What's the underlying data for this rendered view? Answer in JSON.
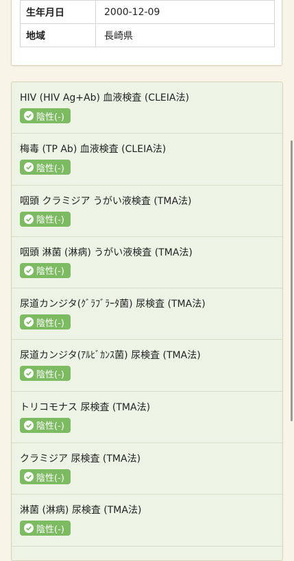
{
  "profile": {
    "rows": [
      {
        "label": "生年月日",
        "value": "2000-12-09"
      },
      {
        "label": "地域",
        "value": "長崎県"
      }
    ]
  },
  "results": [
    {
      "name": "HIV (HIV Ag+Ab) 血液検査 (CLEIA法)",
      "status": "陰性(-)"
    },
    {
      "name": "梅毒 (TP Ab) 血液検査 (CLEIA法)",
      "status": "陰性(-)"
    },
    {
      "name": "咽頭 クラミジア うがい液検査 (TMA法)",
      "status": "陰性(-)"
    },
    {
      "name": "咽頭 淋菌 (淋病) うがい液検査 (TMA法)",
      "status": "陰性(-)"
    },
    {
      "name": "尿道カンジタ(ｸﾞﾗﾌﾞﾗｰﾀ菌) 尿検査 (TMA法)",
      "status": "陰性(-)"
    },
    {
      "name": "尿道カンジタ(ｱﾙﾋﾞｶﾝｽ菌) 尿検査 (TMA法)",
      "status": "陰性(-)"
    },
    {
      "name": "トリコモナス 尿検査 (TMA法)",
      "status": "陰性(-)"
    },
    {
      "name": "クラミジア 尿検査 (TMA法)",
      "status": "陰性(-)"
    },
    {
      "name": "淋菌 (淋病) 尿検査 (TMA法)",
      "status": "陰性(-)"
    }
  ],
  "colors": {
    "page_background": "#f8f4e8",
    "results_background": "#edf4e5",
    "negative_badge": "#7dbb63"
  },
  "icons": {
    "status": "check-circle-icon"
  }
}
